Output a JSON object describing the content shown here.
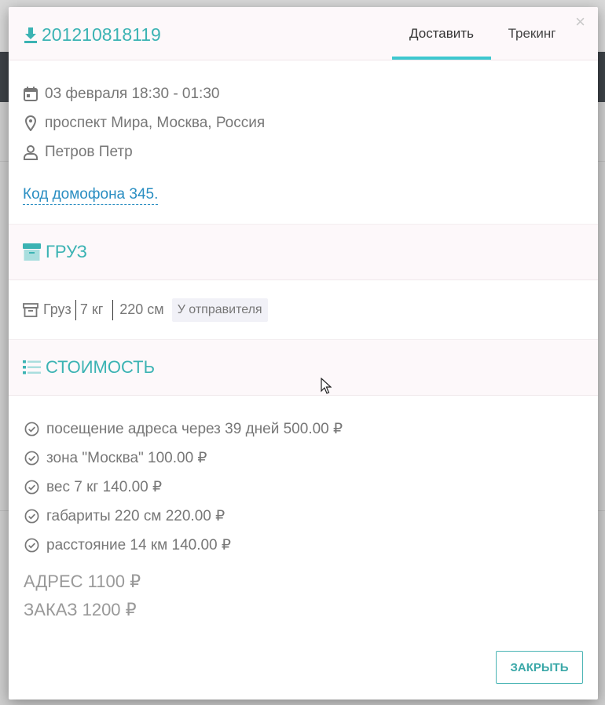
{
  "order": {
    "number": "201210818119",
    "icon": "download-icon"
  },
  "tabs": [
    {
      "label": "Доставить",
      "active": true
    },
    {
      "label": "Трекинг",
      "active": false
    }
  ],
  "close_symbol": "×",
  "details": {
    "date": "03 февраля 18:30 - 01:30",
    "address": "проспект Мира, Москва, Россия",
    "contact": "Петров Петр",
    "intercom": "Код домофона 345."
  },
  "cargo_section": {
    "title": "ГРУЗ",
    "name": "Груз",
    "weight": "7 кг",
    "size": "220 см",
    "status": "У отправителя"
  },
  "cost_section": {
    "title": "СТОИМОСТЬ",
    "items": [
      "посещение адреса через 39 дней 500.00 ₽",
      "зона \"Москва\" 100.00 ₽",
      "вес 7 кг 140.00 ₽",
      "габариты 220 см 220.00 ₽",
      "расстояние 14 км 140.00 ₽"
    ],
    "address_total": "АДРЕС 1100 ₽",
    "order_total": "ЗАКАЗ 1200 ₽"
  },
  "buttons": {
    "close": "ЗАКРЫТЬ"
  },
  "colors": {
    "accent": "#3bb3b3",
    "tab_underline": "#3ec7cf",
    "link": "#2a8ec2"
  }
}
